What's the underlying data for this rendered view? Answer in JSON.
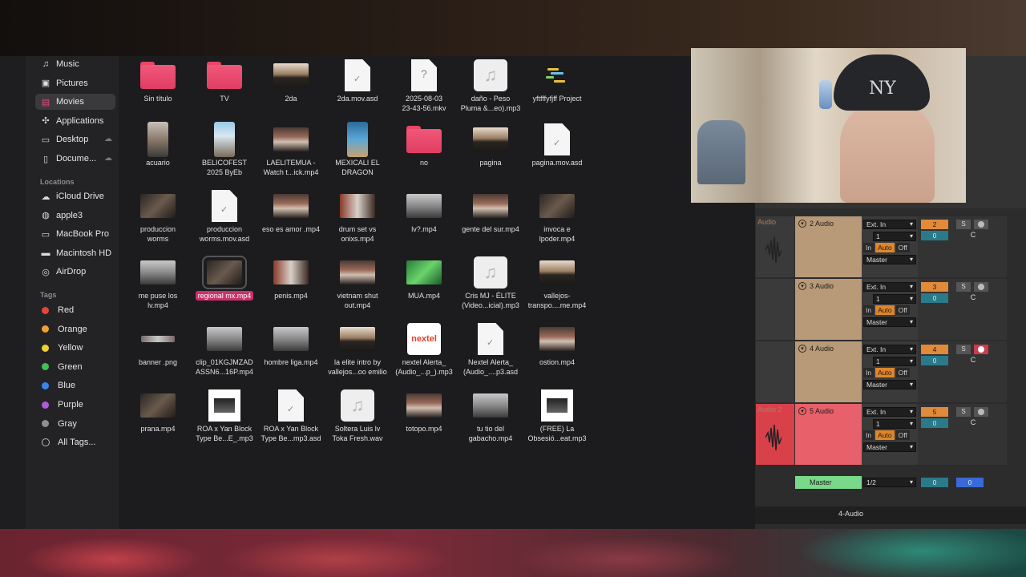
{
  "sidebar": {
    "favorites": [
      {
        "label": "Music",
        "icon": "music-note-icon"
      },
      {
        "label": "Pictures",
        "icon": "pictures-icon"
      },
      {
        "label": "Movies",
        "icon": "movies-icon",
        "active": true
      },
      {
        "label": "Applications",
        "icon": "applications-icon"
      },
      {
        "label": "Desktop",
        "icon": "desktop-icon"
      },
      {
        "label": "Docume...",
        "icon": "document-icon"
      }
    ],
    "locations_header": "Locations",
    "locations": [
      {
        "label": "iCloud Drive",
        "icon": "cloud-icon"
      },
      {
        "label": "apple3",
        "icon": "globe-icon"
      },
      {
        "label": "MacBook Pro",
        "icon": "laptop-icon"
      },
      {
        "label": "Macintosh HD",
        "icon": "disk-icon"
      },
      {
        "label": "AirDrop",
        "icon": "airdrop-icon"
      }
    ],
    "tags_header": "Tags",
    "tags": [
      {
        "label": "Red",
        "color": "#e8443c"
      },
      {
        "label": "Orange",
        "color": "#f0a030"
      },
      {
        "label": "Yellow",
        "color": "#f0d030"
      },
      {
        "label": "Green",
        "color": "#40c050"
      },
      {
        "label": "Blue",
        "color": "#3a84f0"
      },
      {
        "label": "Purple",
        "color": "#b05ad8"
      },
      {
        "label": "Gray",
        "color": "#8e8e93"
      },
      {
        "label": "All Tags..."
      }
    ]
  },
  "files": [
    {
      "label": "Sin título",
      "kind": "folder"
    },
    {
      "label": "TV",
      "kind": "folder"
    },
    {
      "label": "2da",
      "kind": "video-sunset"
    },
    {
      "label": "2da.mov.asd",
      "kind": "doc"
    },
    {
      "label": "2025-08-03\n23-43-56.mkv",
      "kind": "doc-q"
    },
    {
      "label": "daño - Peso\nPluma &...eo).mp3",
      "kind": "music"
    },
    {
      "label": "yftfffyfjff Project",
      "kind": "project"
    },
    {
      "label": "acuario",
      "kind": "video-phone2"
    },
    {
      "label": "BELICOFEST\n2025 ByEb",
      "kind": "video-phone"
    },
    {
      "label": "LAELITEMUA -\nWatch t...ick.mp4",
      "kind": "video-crowd"
    },
    {
      "label": "MEXICALI EL\nDRAGON",
      "kind": "video-phone3"
    },
    {
      "label": "no",
      "kind": "folder"
    },
    {
      "label": "pagina",
      "kind": "video-sunset"
    },
    {
      "label": "pagina.mov.asd",
      "kind": "doc"
    },
    {
      "label": "produccion\nworms",
      "kind": "video-dark"
    },
    {
      "label": "produccion\nworms.mov.asd",
      "kind": "doc"
    },
    {
      "label": "eso es amor .mp4",
      "kind": "video-crowd"
    },
    {
      "label": "drum set vs\nonixs.mp4",
      "kind": "video-drum"
    },
    {
      "label": "lv?.mp4",
      "kind": "video-light"
    },
    {
      "label": "gente del sur.mp4",
      "kind": "video-crowd"
    },
    {
      "label": "invoca e\nlpoder.mp4",
      "kind": "video-dark"
    },
    {
      "label": "me puse los\nlv.mp4",
      "kind": "video-light"
    },
    {
      "label": "regional mx.mp4",
      "kind": "video-dark",
      "selected": true
    },
    {
      "label": "penis.mp4",
      "kind": "video-drum"
    },
    {
      "label": "vietnam shut\nout.mp4",
      "kind": "video-crowd"
    },
    {
      "label": "MUA.mp4",
      "kind": "video-green"
    },
    {
      "label": "Cris MJ - ÉLITE\n(Video...icial).mp3",
      "kind": "music"
    },
    {
      "label": "vallejos-\ntranspo....me.mp4",
      "kind": "video-sunset"
    },
    {
      "label": "banner .png",
      "kind": "banner"
    },
    {
      "label": "clip_01KGJMZAD\nASSN6...16P.mp4",
      "kind": "video-light"
    },
    {
      "label": "hombre liga.mp4",
      "kind": "video-light"
    },
    {
      "label": "la elite intro by\nvallejos...oo emilio",
      "kind": "video-sunset"
    },
    {
      "label": "nextel Alerta_\n(Audio_...p_).mp3",
      "kind": "nextel"
    },
    {
      "label": "Nextel Alerta_\n(Audio_....p3.asd",
      "kind": "doc"
    },
    {
      "label": "ostion.mp4",
      "kind": "video-crowd"
    },
    {
      "label": "prana.mp4",
      "kind": "video-dark"
    },
    {
      "label": "ROA x Yan Block\nType Be...E_.mp3",
      "kind": "video-bw"
    },
    {
      "label": "ROA x Yan Block\nType Be...mp3.asd",
      "kind": "doc"
    },
    {
      "label": "Soltera Luis lv\nToka Fresh.wav",
      "kind": "music"
    },
    {
      "label": "totopo.mp4",
      "kind": "video-crowd"
    },
    {
      "label": "tu tio del\ngabacho.mp4",
      "kind": "video-light"
    },
    {
      "label": "(FREE) La\nObsesió...eat.mp3",
      "kind": "video-bw"
    }
  ],
  "daw": {
    "tracks": [
      {
        "clip": "Audio",
        "name": "2 Audio",
        "input": "Ext. In",
        "channel": "1",
        "monitor": [
          "In",
          "Auto",
          "Off"
        ],
        "output": "Master",
        "number": "2",
        "solo": "S",
        "volume": "0",
        "pan": "C",
        "armed": false
      },
      {
        "clip": "",
        "name": "3 Audio",
        "input": "Ext. In",
        "channel": "1",
        "monitor": [
          "In",
          "Auto",
          "Off"
        ],
        "output": "Master",
        "number": "3",
        "solo": "S",
        "volume": "0",
        "pan": "C",
        "armed": false
      },
      {
        "clip": "",
        "name": "4 Audio",
        "input": "Ext. In",
        "channel": "1",
        "monitor": [
          "In",
          "Auto",
          "Off"
        ],
        "output": "Master",
        "number": "4",
        "solo": "S",
        "volume": "0",
        "pan": "C",
        "armed": true
      },
      {
        "clip": "Audio 2",
        "name": "5 Audio",
        "input": "Ext. In",
        "channel": "1",
        "monitor": [
          "In",
          "Auto",
          "Off"
        ],
        "output": "Master",
        "number": "5",
        "solo": "S",
        "volume": "0",
        "pan": "C",
        "armed": false
      }
    ],
    "master": {
      "name": "Master",
      "routing": "1/2",
      "volume_left": "0",
      "volume_right": "0"
    },
    "status_label": "4-Audio",
    "top_value": "C"
  }
}
